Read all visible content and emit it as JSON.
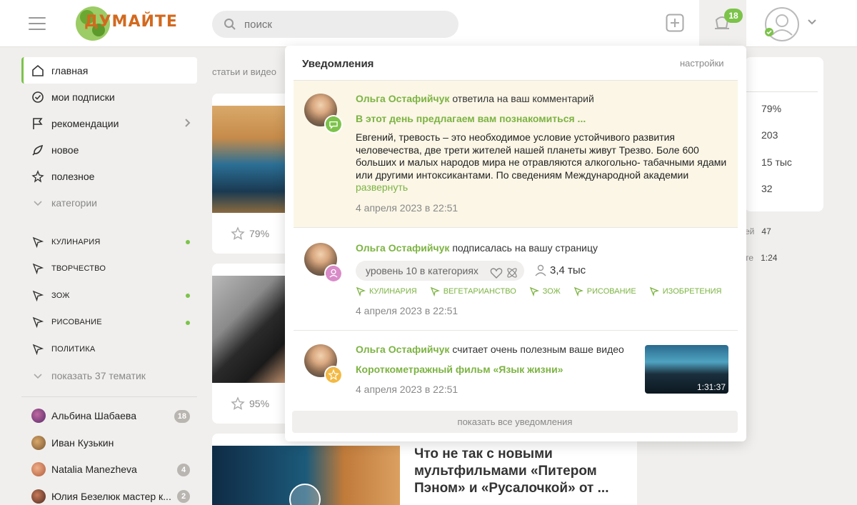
{
  "header": {
    "logo_text": "ДУМАЙТЕ",
    "search_placeholder": "поиск",
    "notification_count": "18",
    "accent": "#7cc34a"
  },
  "sidebar": {
    "nav": [
      {
        "label": "главная",
        "icon": "home-icon"
      },
      {
        "label": "мои подписки",
        "icon": "check-circle-icon"
      },
      {
        "label": "рекомендации",
        "icon": "flag-icon"
      },
      {
        "label": "новое",
        "icon": "rocket-icon"
      },
      {
        "label": "полезное",
        "icon": "sparkle-star-icon"
      },
      {
        "label": "категории",
        "icon": "chevron-down-icon"
      }
    ],
    "categories": [
      {
        "label": "кулинария"
      },
      {
        "label": "творчество"
      },
      {
        "label": "зож"
      },
      {
        "label": "рисование"
      },
      {
        "label": "политика"
      }
    ],
    "show_more": "показать 37 тематик",
    "users": [
      {
        "name": "Альбина Шабаева",
        "badge": "18"
      },
      {
        "name": "Иван Кузькин",
        "badge": ""
      },
      {
        "name": "Natalia Manezheva",
        "badge": "4"
      },
      {
        "name": "Юлия Безелюк мастер к...",
        "badge": "2"
      }
    ]
  },
  "feed": {
    "label": "статьи и видео",
    "cards": [
      {
        "rating": "79%"
      },
      {
        "rating": "95%"
      }
    ],
    "big_card_title": "Что не так с новыми мультфильмами «Питером Пэном» и «Русалочкой»  от ..."
  },
  "stats": {
    "values": [
      "79%",
      "203",
      "15 тыс",
      "32"
    ],
    "extra": [
      {
        "label": "ей",
        "value": "47"
      },
      {
        "label": "те",
        "value": "1:24"
      }
    ]
  },
  "notifications": {
    "title": "Уведомления",
    "settings": "настройки",
    "items": [
      {
        "author": "Ольга Остафийчук",
        "action": "ответила на ваш комментарий",
        "link": "В этот день предлагаем вам познакомиться ...",
        "body": "Евгений, тревость – это необходимое условие устойчивого развития человечества, две трети жителей нашей планеты живут Трезво. Боле 600 больших и малых народов мира не отравляются алкогольно- табачными ядами или другими интоксикантами. По сведениям Международной академии",
        "expand": "развернуть",
        "date": "4 апреля 2023 в 22:51"
      },
      {
        "author": "Ольга Остафийчук",
        "action": "подписалась на вашу страницу",
        "level": "уровень 10 в категориях",
        "followers": "3,4 тыс",
        "categories": [
          "кулинария",
          "вегетарианство",
          "зож",
          "рисование",
          "изобретения"
        ],
        "date": "4 апреля 2023 в 22:51"
      },
      {
        "author": "Ольга Остафийчук",
        "action": "считает очень полезным ваше видео",
        "link": "Короткометражный фильм «Язык жизни»",
        "duration": "1:31:37",
        "date": "4 апреля 2023 в 22:51"
      }
    ],
    "show_all": "показать все уведомления"
  }
}
